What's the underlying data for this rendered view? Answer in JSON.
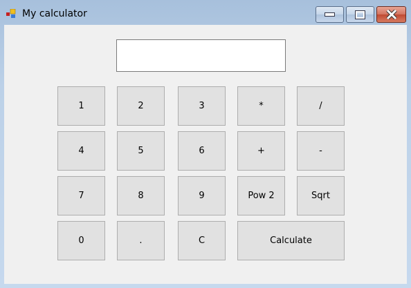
{
  "window": {
    "title": "My calculator"
  },
  "display": {
    "value": ""
  },
  "buttons": {
    "b1": "1",
    "b2": "2",
    "b3": "3",
    "mul": "*",
    "div": "/",
    "b4": "4",
    "b5": "5",
    "b6": "6",
    "add": "+",
    "sub": "-",
    "b7": "7",
    "b8": "8",
    "b9": "9",
    "pow2": "Pow 2",
    "sqrt": "Sqrt",
    "b0": "0",
    "dot": ".",
    "clear": "C",
    "calculate": "Calculate"
  }
}
